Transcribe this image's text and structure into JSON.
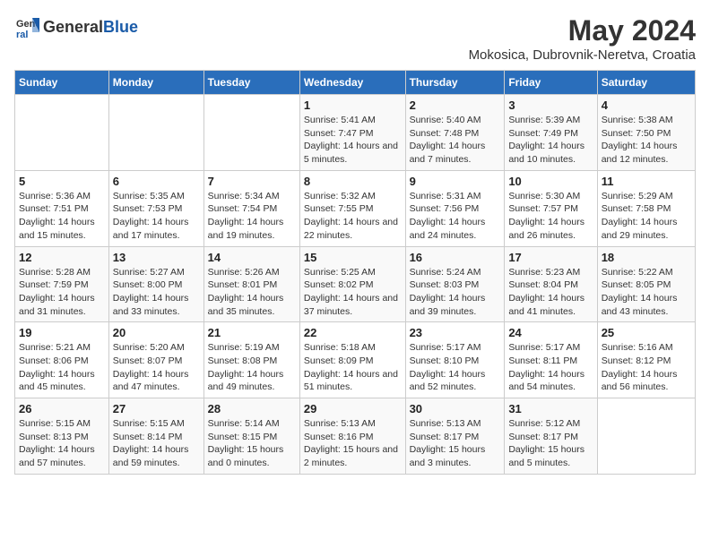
{
  "header": {
    "logo_general": "General",
    "logo_blue": "Blue",
    "title": "May 2024",
    "subtitle": "Mokosica, Dubrovnik-Neretva, Croatia"
  },
  "calendar": {
    "days_of_week": [
      "Sunday",
      "Monday",
      "Tuesday",
      "Wednesday",
      "Thursday",
      "Friday",
      "Saturday"
    ],
    "weeks": [
      [
        {
          "day": "",
          "sunrise": "",
          "sunset": "",
          "daylight": ""
        },
        {
          "day": "",
          "sunrise": "",
          "sunset": "",
          "daylight": ""
        },
        {
          "day": "",
          "sunrise": "",
          "sunset": "",
          "daylight": ""
        },
        {
          "day": "1",
          "sunrise": "Sunrise: 5:41 AM",
          "sunset": "Sunset: 7:47 PM",
          "daylight": "Daylight: 14 hours and 5 minutes."
        },
        {
          "day": "2",
          "sunrise": "Sunrise: 5:40 AM",
          "sunset": "Sunset: 7:48 PM",
          "daylight": "Daylight: 14 hours and 7 minutes."
        },
        {
          "day": "3",
          "sunrise": "Sunrise: 5:39 AM",
          "sunset": "Sunset: 7:49 PM",
          "daylight": "Daylight: 14 hours and 10 minutes."
        },
        {
          "day": "4",
          "sunrise": "Sunrise: 5:38 AM",
          "sunset": "Sunset: 7:50 PM",
          "daylight": "Daylight: 14 hours and 12 minutes."
        }
      ],
      [
        {
          "day": "5",
          "sunrise": "Sunrise: 5:36 AM",
          "sunset": "Sunset: 7:51 PM",
          "daylight": "Daylight: 14 hours and 15 minutes."
        },
        {
          "day": "6",
          "sunrise": "Sunrise: 5:35 AM",
          "sunset": "Sunset: 7:53 PM",
          "daylight": "Daylight: 14 hours and 17 minutes."
        },
        {
          "day": "7",
          "sunrise": "Sunrise: 5:34 AM",
          "sunset": "Sunset: 7:54 PM",
          "daylight": "Daylight: 14 hours and 19 minutes."
        },
        {
          "day": "8",
          "sunrise": "Sunrise: 5:32 AM",
          "sunset": "Sunset: 7:55 PM",
          "daylight": "Daylight: 14 hours and 22 minutes."
        },
        {
          "day": "9",
          "sunrise": "Sunrise: 5:31 AM",
          "sunset": "Sunset: 7:56 PM",
          "daylight": "Daylight: 14 hours and 24 minutes."
        },
        {
          "day": "10",
          "sunrise": "Sunrise: 5:30 AM",
          "sunset": "Sunset: 7:57 PM",
          "daylight": "Daylight: 14 hours and 26 minutes."
        },
        {
          "day": "11",
          "sunrise": "Sunrise: 5:29 AM",
          "sunset": "Sunset: 7:58 PM",
          "daylight": "Daylight: 14 hours and 29 minutes."
        }
      ],
      [
        {
          "day": "12",
          "sunrise": "Sunrise: 5:28 AM",
          "sunset": "Sunset: 7:59 PM",
          "daylight": "Daylight: 14 hours and 31 minutes."
        },
        {
          "day": "13",
          "sunrise": "Sunrise: 5:27 AM",
          "sunset": "Sunset: 8:00 PM",
          "daylight": "Daylight: 14 hours and 33 minutes."
        },
        {
          "day": "14",
          "sunrise": "Sunrise: 5:26 AM",
          "sunset": "Sunset: 8:01 PM",
          "daylight": "Daylight: 14 hours and 35 minutes."
        },
        {
          "day": "15",
          "sunrise": "Sunrise: 5:25 AM",
          "sunset": "Sunset: 8:02 PM",
          "daylight": "Daylight: 14 hours and 37 minutes."
        },
        {
          "day": "16",
          "sunrise": "Sunrise: 5:24 AM",
          "sunset": "Sunset: 8:03 PM",
          "daylight": "Daylight: 14 hours and 39 minutes."
        },
        {
          "day": "17",
          "sunrise": "Sunrise: 5:23 AM",
          "sunset": "Sunset: 8:04 PM",
          "daylight": "Daylight: 14 hours and 41 minutes."
        },
        {
          "day": "18",
          "sunrise": "Sunrise: 5:22 AM",
          "sunset": "Sunset: 8:05 PM",
          "daylight": "Daylight: 14 hours and 43 minutes."
        }
      ],
      [
        {
          "day": "19",
          "sunrise": "Sunrise: 5:21 AM",
          "sunset": "Sunset: 8:06 PM",
          "daylight": "Daylight: 14 hours and 45 minutes."
        },
        {
          "day": "20",
          "sunrise": "Sunrise: 5:20 AM",
          "sunset": "Sunset: 8:07 PM",
          "daylight": "Daylight: 14 hours and 47 minutes."
        },
        {
          "day": "21",
          "sunrise": "Sunrise: 5:19 AM",
          "sunset": "Sunset: 8:08 PM",
          "daylight": "Daylight: 14 hours and 49 minutes."
        },
        {
          "day": "22",
          "sunrise": "Sunrise: 5:18 AM",
          "sunset": "Sunset: 8:09 PM",
          "daylight": "Daylight: 14 hours and 51 minutes."
        },
        {
          "day": "23",
          "sunrise": "Sunrise: 5:17 AM",
          "sunset": "Sunset: 8:10 PM",
          "daylight": "Daylight: 14 hours and 52 minutes."
        },
        {
          "day": "24",
          "sunrise": "Sunrise: 5:17 AM",
          "sunset": "Sunset: 8:11 PM",
          "daylight": "Daylight: 14 hours and 54 minutes."
        },
        {
          "day": "25",
          "sunrise": "Sunrise: 5:16 AM",
          "sunset": "Sunset: 8:12 PM",
          "daylight": "Daylight: 14 hours and 56 minutes."
        }
      ],
      [
        {
          "day": "26",
          "sunrise": "Sunrise: 5:15 AM",
          "sunset": "Sunset: 8:13 PM",
          "daylight": "Daylight: 14 hours and 57 minutes."
        },
        {
          "day": "27",
          "sunrise": "Sunrise: 5:15 AM",
          "sunset": "Sunset: 8:14 PM",
          "daylight": "Daylight: 14 hours and 59 minutes."
        },
        {
          "day": "28",
          "sunrise": "Sunrise: 5:14 AM",
          "sunset": "Sunset: 8:15 PM",
          "daylight": "Daylight: 15 hours and 0 minutes."
        },
        {
          "day": "29",
          "sunrise": "Sunrise: 5:13 AM",
          "sunset": "Sunset: 8:16 PM",
          "daylight": "Daylight: 15 hours and 2 minutes."
        },
        {
          "day": "30",
          "sunrise": "Sunrise: 5:13 AM",
          "sunset": "Sunset: 8:17 PM",
          "daylight": "Daylight: 15 hours and 3 minutes."
        },
        {
          "day": "31",
          "sunrise": "Sunrise: 5:12 AM",
          "sunset": "Sunset: 8:17 PM",
          "daylight": "Daylight: 15 hours and 5 minutes."
        },
        {
          "day": "",
          "sunrise": "",
          "sunset": "",
          "daylight": ""
        }
      ]
    ]
  }
}
